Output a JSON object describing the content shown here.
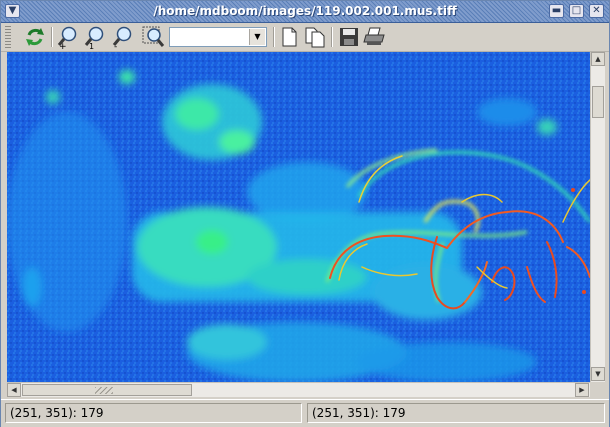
{
  "window": {
    "title": "/home/mdboom/images/119.002.001.mus.tiff",
    "controls": {
      "menu_icon": "chevron-down-icon",
      "minimize_icon": "minimize-icon",
      "maximize_icon": "maximize-icon",
      "close_icon": "close-icon"
    }
  },
  "toolbar": {
    "items": [
      {
        "name": "refresh-button",
        "icon": "refresh-icon"
      },
      {
        "name": "zoom-in-button",
        "icon": "zoom-in-icon"
      },
      {
        "name": "zoom-actual-button",
        "icon": "zoom-1-icon",
        "badge": "1"
      },
      {
        "name": "zoom-out-button",
        "icon": "zoom-out-icon"
      },
      {
        "name": "zoom-fit-button",
        "icon": "zoom-fit-icon"
      },
      {
        "name": "zoom-combo",
        "icon": "chevron-down-icon"
      },
      {
        "name": "new-page-button",
        "icon": "page-icon"
      },
      {
        "name": "copy-page-button",
        "icon": "pages-icon"
      },
      {
        "name": "save-button",
        "icon": "floppy-disk-icon"
      },
      {
        "name": "print-button",
        "icon": "printer-icon"
      }
    ],
    "zoom_value": ""
  },
  "status": {
    "left": "(251, 351): 179",
    "right": "(251, 351): 179"
  },
  "colors": {
    "image_background": "#1a5dd8",
    "image_highlight": "#3cf0a0",
    "title_bar": "#6d8ec4"
  }
}
